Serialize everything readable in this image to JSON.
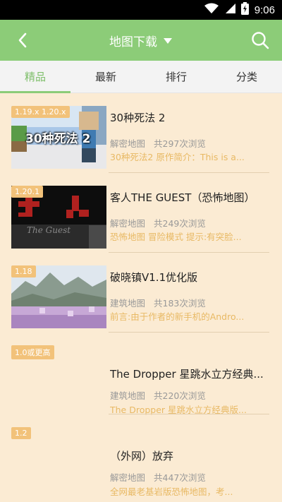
{
  "status_bar": {
    "time": "9:06",
    "icons": [
      "wifi-icon",
      "signal-icon",
      "battery-charging-icon"
    ]
  },
  "app_bar": {
    "title": "地图下载",
    "back_icon": "back-chevron-icon",
    "dropdown_icon": "dropdown-triangle-icon",
    "search_icon": "search-icon"
  },
  "tabs": [
    {
      "label": "精品",
      "active": true
    },
    {
      "label": "最新",
      "active": false
    },
    {
      "label": "排行",
      "active": false
    },
    {
      "label": "分类",
      "active": false
    }
  ],
  "items": [
    {
      "version": "1.19.x 1.20.x",
      "title": "30种死法 2",
      "category": "解密地图",
      "views": "共297次浏览",
      "desc": "30种死法2 原作简介：This is a...",
      "thumb_caption": "30种死法 2"
    },
    {
      "version": "1.20.1",
      "title": "客人THE GUEST（恐怖地图）",
      "category": "解密地图",
      "views": "共249次浏览",
      "desc": "恐怖地图 冒险模式 提示:有突脸...",
      "thumb_caption": "The Guest"
    },
    {
      "version": "1.18",
      "title": "破晓镇V1.1优化版",
      "category": "建筑地图",
      "views": "共183次浏览",
      "desc": "前言:由于作者的新手机的Andro..."
    },
    {
      "version": "1.0或更高",
      "title": "The Dropper 星跳水立方经典...",
      "category": "建筑地图",
      "views": "共220次浏览",
      "desc": "The Dropper 星跳水立方经典版..."
    },
    {
      "version": "1.2",
      "title": "（外网）放弃",
      "category": "解密地图",
      "views": "共447次浏览",
      "desc": "全网最老基岩版恐怖地图，考..."
    }
  ],
  "colors": {
    "accent": "#8ccc78",
    "badge": "#f2c27a",
    "desc": "#e8b964",
    "background": "#fbebd3"
  }
}
